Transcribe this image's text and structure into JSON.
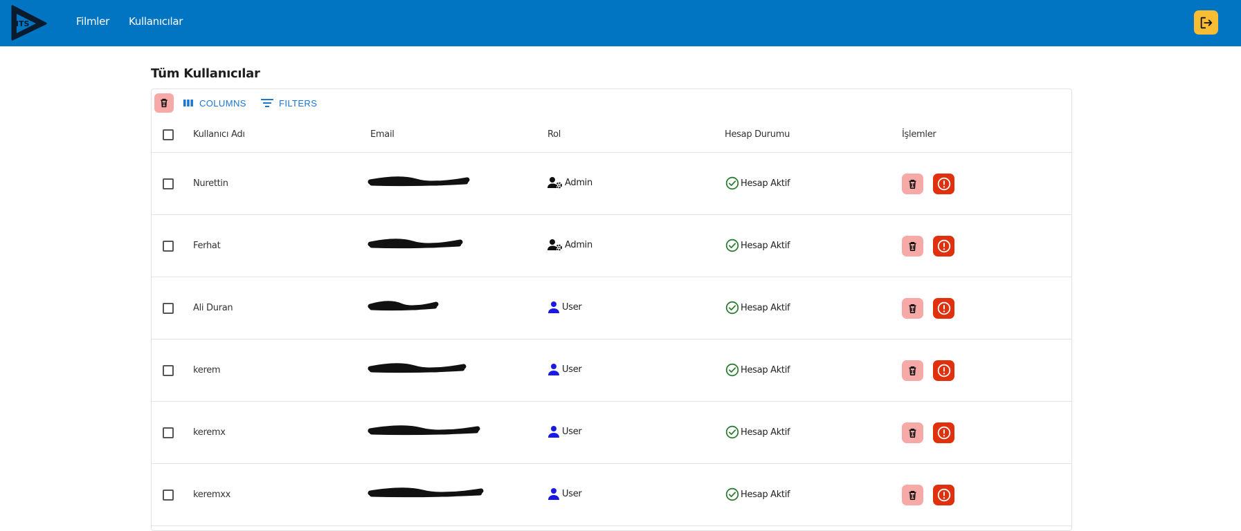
{
  "nav": {
    "logo_text": "MTS",
    "links": [
      {
        "label": "Filmler"
      },
      {
        "label": "Kullanıcılar"
      }
    ],
    "logout_icon": "logout-icon"
  },
  "page": {
    "title": "Tüm Kullanıcılar"
  },
  "toolbar": {
    "delete_icon": "trash-icon",
    "columns_label": "COLUMNS",
    "filters_label": "FILTERS"
  },
  "table": {
    "headers": {
      "username": "Kullanıcı Adı",
      "email": "Email",
      "role": "Rol",
      "status": "Hesap Durumu",
      "actions": "İşlemler"
    },
    "rows": [
      {
        "username": "Nurettin",
        "role": "Admin",
        "status": "Hesap Aktif"
      },
      {
        "username": "Ferhat",
        "role": "Admin",
        "status": "Hesap Aktif"
      },
      {
        "username": "Ali Duran",
        "role": "User",
        "status": "Hesap Aktif"
      },
      {
        "username": "kerem",
        "role": "User",
        "status": "Hesap Aktif"
      },
      {
        "username": "keremx",
        "role": "User",
        "status": "Hesap Aktif"
      },
      {
        "username": "keremxx",
        "role": "User",
        "status": "Hesap Aktif"
      }
    ]
  },
  "colors": {
    "topbar": "#0175c2",
    "logout": "#f9bd33",
    "primary": "#1976d2",
    "delete_bg": "#f7a9a7",
    "warn_bg": "#e1300e",
    "status_green": "#2e7d32",
    "user_icon": "#1a1ae6"
  }
}
